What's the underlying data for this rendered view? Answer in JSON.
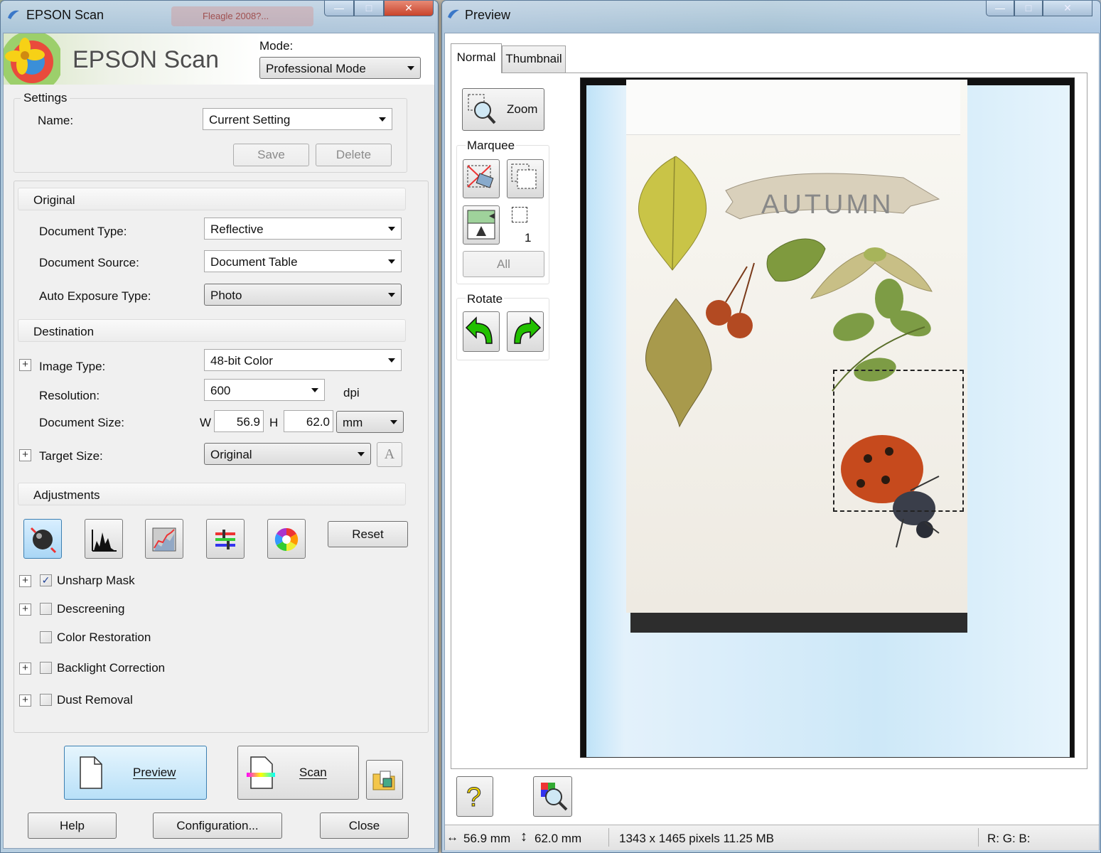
{
  "left_window": {
    "title": "EPSON Scan",
    "background_tab_text": "Fleagle 2008?...",
    "banner_text": "EPSON Scan",
    "mode_label": "Mode:",
    "mode_value": "Professional Mode",
    "settings": {
      "group_label": "Settings",
      "name_label": "Name:",
      "name_value": "Current Setting",
      "save_label": "Save",
      "delete_label": "Delete"
    },
    "original": {
      "header": "Original",
      "document_type_label": "Document Type:",
      "document_type_value": "Reflective",
      "document_source_label": "Document Source:",
      "document_source_value": "Document Table",
      "auto_exposure_label": "Auto Exposure Type:",
      "auto_exposure_value": "Photo"
    },
    "destination": {
      "header": "Destination",
      "image_type_label": "Image Type:",
      "image_type_value": "48-bit Color",
      "resolution_label": "Resolution:",
      "resolution_value": "600",
      "resolution_unit": "dpi",
      "document_size_label": "Document Size:",
      "w_label": "W",
      "w_value": "56.9",
      "h_label": "H",
      "h_value": "62.0",
      "size_unit": "mm",
      "target_size_label": "Target Size:",
      "target_size_value": "Original",
      "text_enhance_glyph": "A"
    },
    "adjustments": {
      "header": "Adjustments",
      "reset_label": "Reset",
      "options": [
        {
          "label": "Unsharp Mask",
          "checked": true,
          "expandable": true
        },
        {
          "label": "Descreening",
          "checked": false,
          "expandable": true
        },
        {
          "label": "Color Restoration",
          "checked": false,
          "expandable": false
        },
        {
          "label": "Backlight Correction",
          "checked": false,
          "expandable": true
        },
        {
          "label": "Dust Removal",
          "checked": false,
          "expandable": true
        }
      ]
    },
    "preview_label": "Preview",
    "scan_label": "Scan",
    "help_label": "Help",
    "configuration_label": "Configuration...",
    "close_label": "Close"
  },
  "right_window": {
    "title": "Preview",
    "tabs": [
      "Normal",
      "Thumbnail"
    ],
    "active_tab": "Normal",
    "zoom_label": "Zoom",
    "marquee_label": "Marquee",
    "marquee_count": "1",
    "all_label": "All",
    "rotate_label": "Rotate",
    "image_text": "AUTUMN",
    "status": {
      "width": "56.9 mm",
      "height": "62.0 mm",
      "pixels": "1343 x 1465 pixels 11.25 MB",
      "rgb": "R: G: B:"
    }
  },
  "colors": {
    "accent_blue": "#bfe3f8",
    "title_bar": "#b9d1ea",
    "close_red": "#c8432b",
    "rotate_green": "#22c000"
  }
}
